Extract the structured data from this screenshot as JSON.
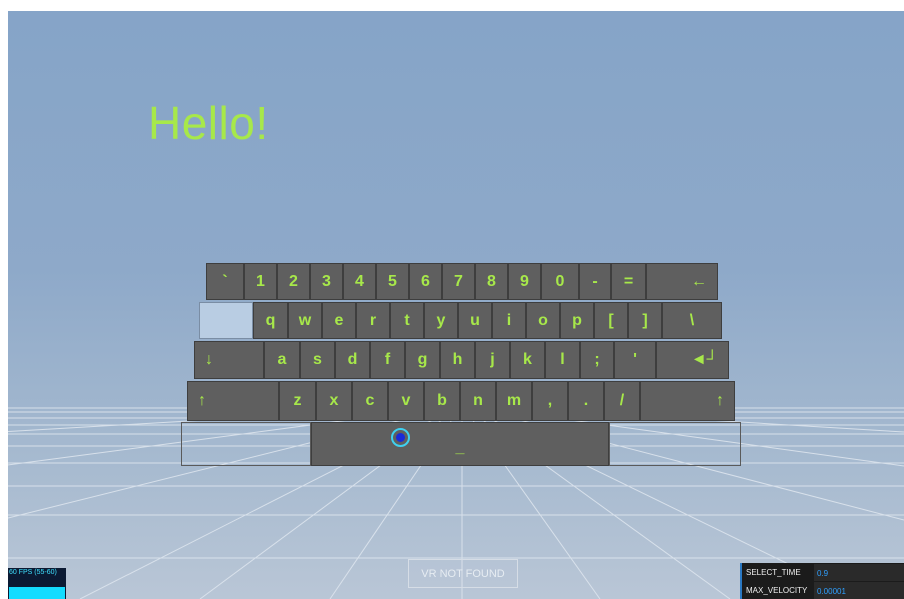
{
  "scene": {
    "greeting": "Hello!",
    "vr_button": "VR NOT FOUND"
  },
  "keyboard": {
    "rows": [
      [
        "`",
        "1",
        "2",
        "3",
        "4",
        "5",
        "6",
        "7",
        "8",
        "9",
        "0",
        "-",
        "=",
        "←"
      ],
      [
        "",
        "q",
        "w",
        "e",
        "r",
        "t",
        "y",
        "u",
        "i",
        "o",
        "p",
        "[",
        "]",
        "\\"
      ],
      [
        "↓",
        "a",
        "s",
        "d",
        "f",
        "g",
        "h",
        "j",
        "k",
        "l",
        ";",
        "'",
        "◄┘"
      ],
      [
        "↑",
        "z",
        "x",
        "c",
        "v",
        "b",
        "n",
        "m",
        ",",
        ".",
        "/",
        "↑"
      ],
      [
        "",
        "_",
        ""
      ]
    ]
  },
  "stats": {
    "fps_label": "60 FPS (55-60)"
  },
  "params": [
    {
      "name": "SELECT_TIME",
      "value": "0.9"
    },
    {
      "name": "MAX_VELOCITY",
      "value": "0.00001"
    }
  ],
  "colors": {
    "key_text": "#a7e84a",
    "key_bg": "#5f5f5f",
    "cursor_ring": "#3fd0f0",
    "cursor_dot": "#1a2bd8"
  }
}
